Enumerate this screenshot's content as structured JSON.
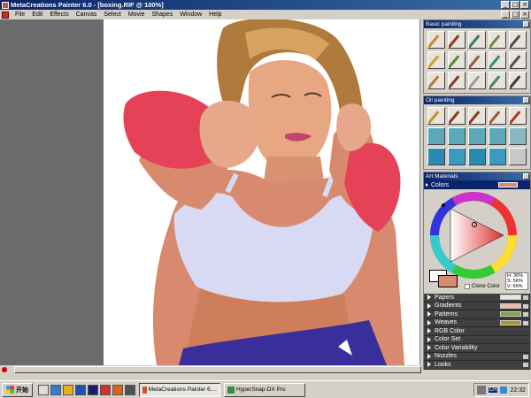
{
  "window": {
    "title": "MetaCreations Painter 6.0 - [boxing.RIF @ 100%]",
    "controls": [
      "_",
      "□",
      "×"
    ]
  },
  "menu": [
    "File",
    "Edit",
    "Effects",
    "Canvas",
    "Select",
    "Movie",
    "Shapes",
    "Window",
    "Help"
  ],
  "palettes": {
    "basic_title": "Basic painting",
    "oil_title": "Oil painting",
    "art_title": "Art Materials",
    "colors_label": "Colors",
    "hsv": {
      "h": "H: 36%",
      "s": "S: 56%",
      "v": "V: 66%"
    },
    "clone_label": "Clone Color",
    "current_color": "#d88a6e",
    "rows": [
      {
        "label": "Papers",
        "preview": "#e9e5e0"
      },
      {
        "label": "Gradients",
        "preview": "#f2b7a6"
      },
      {
        "label": "Patterns",
        "preview": "#7aa34a"
      },
      {
        "label": "Weaves",
        "preview": "#a89a2a"
      },
      {
        "label": "RGB Color",
        "preview": ""
      },
      {
        "label": "Color Set",
        "preview": ""
      },
      {
        "label": "Color Variability",
        "preview": ""
      },
      {
        "label": "Nozzles",
        "preview": ""
      },
      {
        "label": "Looks",
        "preview": ""
      }
    ]
  },
  "taskbar": {
    "start_label": "开始",
    "tasks": [
      {
        "label": "MetaCreations Painter 6....",
        "active": true
      },
      {
        "label": "HyperSnap-DX Pro",
        "active": false
      }
    ],
    "tray_lang": "CH",
    "clock": "22:32"
  }
}
